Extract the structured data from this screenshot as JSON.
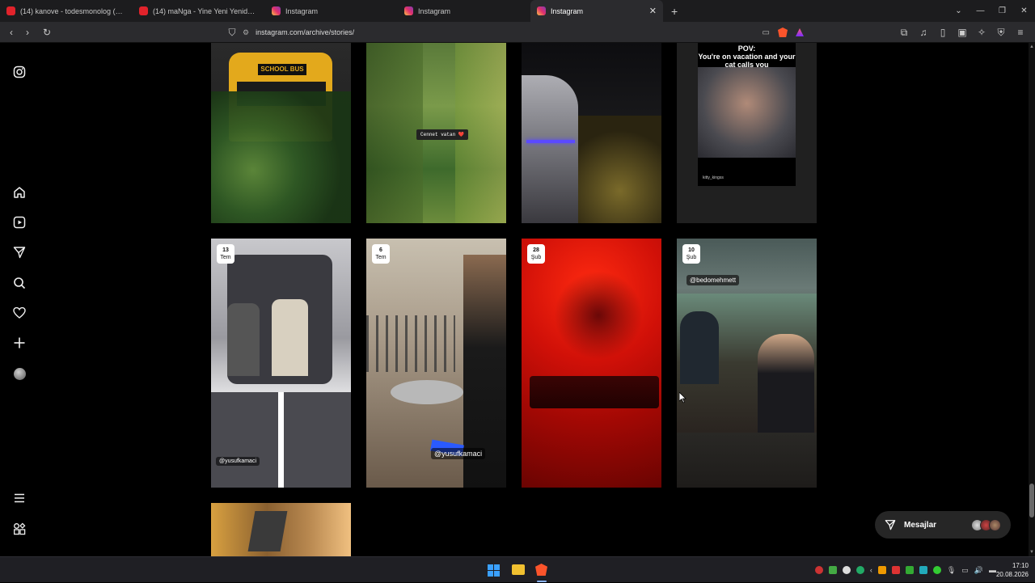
{
  "browser": {
    "tabs": [
      {
        "title": "(14) kanove - todesmonolog (prod.k",
        "favicon": "youtube-icon",
        "active": false
      },
      {
        "title": "(14) maNga - Yine Yeni Yeniden (Yen",
        "favicon": "youtube-icon",
        "active": false
      },
      {
        "title": "Instagram",
        "favicon": "instagram-icon",
        "active": false
      },
      {
        "title": "Instagram",
        "favicon": "instagram-icon",
        "active": false
      },
      {
        "title": "Instagram",
        "favicon": "instagram-icon",
        "active": true
      }
    ],
    "new_tab": "+",
    "address": "instagram.com/archive/stories/"
  },
  "grid": {
    "row1": [
      {
        "type": "school-bus",
        "sticker": ""
      },
      {
        "type": "forest",
        "sticker": "Cennet vatan ❤️"
      },
      {
        "type": "car-night",
        "sticker": ""
      },
      {
        "type": "meme",
        "meme_text": "POV:\nYou're on vacation and your cat calls you",
        "credit": "kitty_kingss"
      }
    ],
    "row2": [
      {
        "day": "13",
        "month": "Tem",
        "mention": "@yusufkamaci"
      },
      {
        "day": "6",
        "month": "Tem",
        "mention": "@yusufkamaci"
      },
      {
        "day": "28",
        "month": "Şub",
        "mention": ""
      },
      {
        "day": "10",
        "month": "Şub",
        "mention": "@bedomehmett"
      }
    ]
  },
  "messages": {
    "label": "Mesajlar"
  },
  "taskbar": {
    "time": "17:10",
    "date": "20.08.2026"
  },
  "colors": {
    "accent_red": "#e2231a",
    "instagram_gradient": "#e1306c"
  }
}
